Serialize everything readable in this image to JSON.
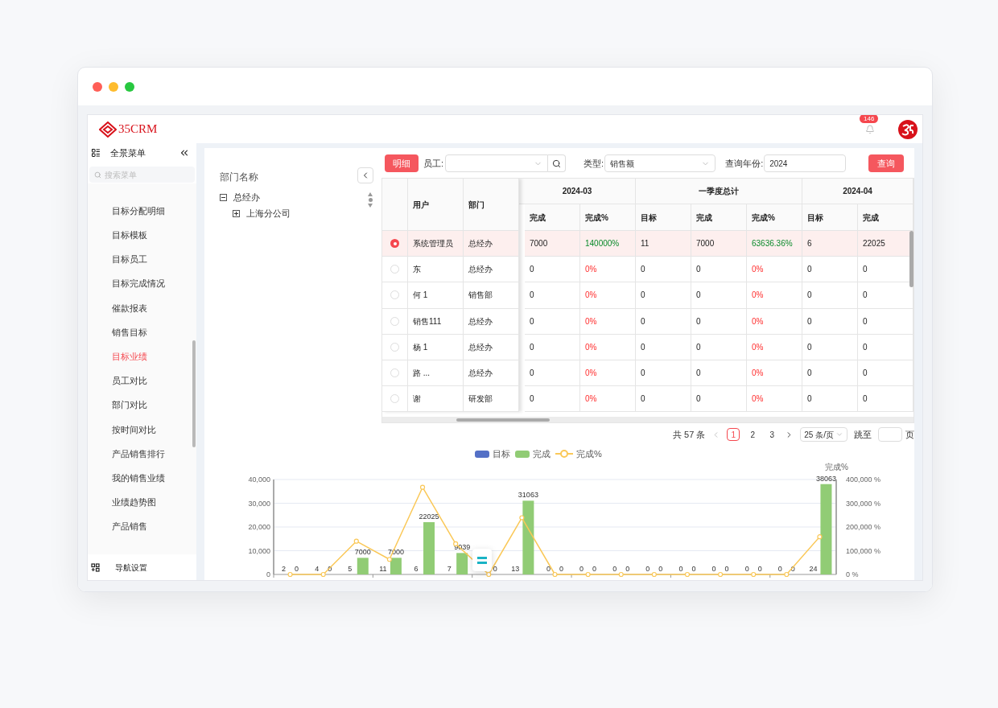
{
  "header": {
    "logo_text": "35CRM",
    "notification_count": "146"
  },
  "sidebar": {
    "title": "全景菜单",
    "search_placeholder": "搜索菜单",
    "items": [
      {
        "label": "目标分配明细",
        "selected": false
      },
      {
        "label": "目标模板",
        "selected": false
      },
      {
        "label": "目标员工",
        "selected": false
      },
      {
        "label": "目标完成情况",
        "selected": false
      },
      {
        "label": "催款报表",
        "selected": false
      },
      {
        "label": "销售目标",
        "selected": false
      },
      {
        "label": "目标业绩",
        "selected": true
      },
      {
        "label": "员工对比",
        "selected": false
      },
      {
        "label": "部门对比",
        "selected": false
      },
      {
        "label": "按时间对比",
        "selected": false
      },
      {
        "label": "产品销售排行",
        "selected": false
      },
      {
        "label": "我的销售业绩",
        "selected": false
      },
      {
        "label": "业绩趋势图",
        "selected": false
      },
      {
        "label": "产品销售",
        "selected": false
      }
    ],
    "footer": "导航设置"
  },
  "tree": {
    "title": "部门名称",
    "nodes": [
      {
        "label": "总经办",
        "expanded": true,
        "children": [
          {
            "label": "上海分公司",
            "expanded": false
          }
        ]
      }
    ]
  },
  "toolbar": {
    "detail_button": "明细",
    "employee_label": "员工:",
    "type_label": "类型:",
    "type_value": "销售额",
    "year_label": "查询年份:",
    "year_value": "2024",
    "query_button": "查询"
  },
  "table": {
    "fixed_columns": [
      "用户",
      "部门"
    ],
    "groups": [
      {
        "title": "2024-03",
        "columns": [
          "完成",
          "完成%"
        ]
      },
      {
        "title": "一季度总计",
        "columns": [
          "目标",
          "完成",
          "完成%"
        ]
      },
      {
        "title": "2024-04",
        "columns": [
          "目标",
          "完成"
        ]
      }
    ],
    "rows": [
      {
        "selected": true,
        "user": "系统管理员",
        "dept": "总经办",
        "cells": [
          {
            "text": "7000",
            "kind": "value"
          },
          {
            "text": "140000%",
            "kind": "good"
          },
          {
            "text": "11",
            "kind": "value"
          },
          {
            "text": "7000",
            "kind": "value"
          },
          {
            "text": "63636.36%",
            "kind": "good"
          },
          {
            "text": "6",
            "kind": "value"
          },
          {
            "text": "22025",
            "kind": "value"
          }
        ]
      },
      {
        "selected": false,
        "user": "东",
        "dept": "总经办",
        "cells": [
          {
            "text": "0",
            "kind": "value"
          },
          {
            "text": "0%",
            "kind": "bad"
          },
          {
            "text": "0",
            "kind": "value"
          },
          {
            "text": "0",
            "kind": "value"
          },
          {
            "text": "0%",
            "kind": "bad"
          },
          {
            "text": "0",
            "kind": "value"
          },
          {
            "text": "0",
            "kind": "value"
          }
        ]
      },
      {
        "selected": false,
        "user": "何 1",
        "dept": "销售部",
        "cells": [
          {
            "text": "0",
            "kind": "value"
          },
          {
            "text": "0%",
            "kind": "bad"
          },
          {
            "text": "0",
            "kind": "value"
          },
          {
            "text": "0",
            "kind": "value"
          },
          {
            "text": "0%",
            "kind": "bad"
          },
          {
            "text": "0",
            "kind": "value"
          },
          {
            "text": "0",
            "kind": "value"
          }
        ]
      },
      {
        "selected": false,
        "user": "销售111",
        "dept": "总经办",
        "cells": [
          {
            "text": "0",
            "kind": "value"
          },
          {
            "text": "0%",
            "kind": "bad"
          },
          {
            "text": "0",
            "kind": "value"
          },
          {
            "text": "0",
            "kind": "value"
          },
          {
            "text": "0%",
            "kind": "bad"
          },
          {
            "text": "0",
            "kind": "value"
          },
          {
            "text": "0",
            "kind": "value"
          }
        ]
      },
      {
        "selected": false,
        "user": "杨 1",
        "dept": "总经办",
        "cells": [
          {
            "text": "0",
            "kind": "value"
          },
          {
            "text": "0%",
            "kind": "bad"
          },
          {
            "text": "0",
            "kind": "value"
          },
          {
            "text": "0",
            "kind": "value"
          },
          {
            "text": "0%",
            "kind": "bad"
          },
          {
            "text": "0",
            "kind": "value"
          },
          {
            "text": "0",
            "kind": "value"
          }
        ]
      },
      {
        "selected": false,
        "user": "路 ...",
        "dept": "总经办",
        "cells": [
          {
            "text": "0",
            "kind": "value"
          },
          {
            "text": "0%",
            "kind": "bad"
          },
          {
            "text": "0",
            "kind": "value"
          },
          {
            "text": "0",
            "kind": "value"
          },
          {
            "text": "0%",
            "kind": "bad"
          },
          {
            "text": "0",
            "kind": "value"
          },
          {
            "text": "0",
            "kind": "value"
          }
        ]
      },
      {
        "selected": false,
        "user": "谢",
        "dept": "研发部",
        "cells": [
          {
            "text": "0",
            "kind": "value"
          },
          {
            "text": "0%",
            "kind": "bad"
          },
          {
            "text": "0",
            "kind": "value"
          },
          {
            "text": "0",
            "kind": "value"
          },
          {
            "text": "0%",
            "kind": "bad"
          },
          {
            "text": "0",
            "kind": "value"
          },
          {
            "text": "0",
            "kind": "value"
          }
        ]
      }
    ]
  },
  "pagination": {
    "total": "共 57 条",
    "pages": [
      {
        "label": "1",
        "selected": true
      },
      {
        "label": "2",
        "selected": false
      },
      {
        "label": "3",
        "selected": false
      }
    ],
    "page_size": "25 条/页",
    "jump_label": "跳至",
    "page_suffix": "页"
  },
  "chart": {
    "chart_data": {
      "type": "bar",
      "ylim": [
        0,
        40000
      ],
      "yticks": [
        0,
        {
          "value": 10000,
          "label": "10,000"
        },
        {
          "value": 20000,
          "label": "20,000"
        },
        {
          "value": 30000,
          "label": "30,000"
        },
        {
          "value": 40000,
          "label": "40,000"
        }
      ],
      "grid": true,
      "legend": "top",
      "data_labels": true,
      "series": [
        {
          "name": "目标",
          "color": "#5470c6",
          "values": [
            2,
            4,
            5,
            11,
            6,
            7,
            null,
            13,
            0,
            0,
            0,
            0,
            0,
            0,
            0,
            0,
            24
          ]
        },
        {
          "name": "完成",
          "color": "#91cc75",
          "values": [
            0,
            0,
            7000,
            7000,
            22025,
            9039,
            0,
            31063,
            0,
            0,
            0,
            0,
            0,
            0,
            0,
            0,
            38063
          ]
        }
      ]
    }
  },
  "percent_chart": {
    "chart_data": {
      "type": "line",
      "ylabel": "完成%",
      "ylim": [
        0,
        400000
      ],
      "yticks": [
        {
          "value": 0,
          "label": "0 %"
        },
        {
          "value": 100000,
          "label": "100,000 %"
        },
        {
          "value": 200000,
          "label": "200,000 %"
        },
        {
          "value": 300000,
          "label": "300,000 %"
        },
        {
          "value": 400000,
          "label": "400,000 %"
        }
      ],
      "legend": "top",
      "series": [
        {
          "name": "完成%",
          "color": "#fac858",
          "marker": "circle",
          "values": [
            0,
            0,
            140000,
            63600,
            367100,
            129100,
            0,
            238900,
            0,
            0,
            0,
            0,
            0,
            0,
            0,
            0,
            158600
          ]
        }
      ]
    }
  }
}
